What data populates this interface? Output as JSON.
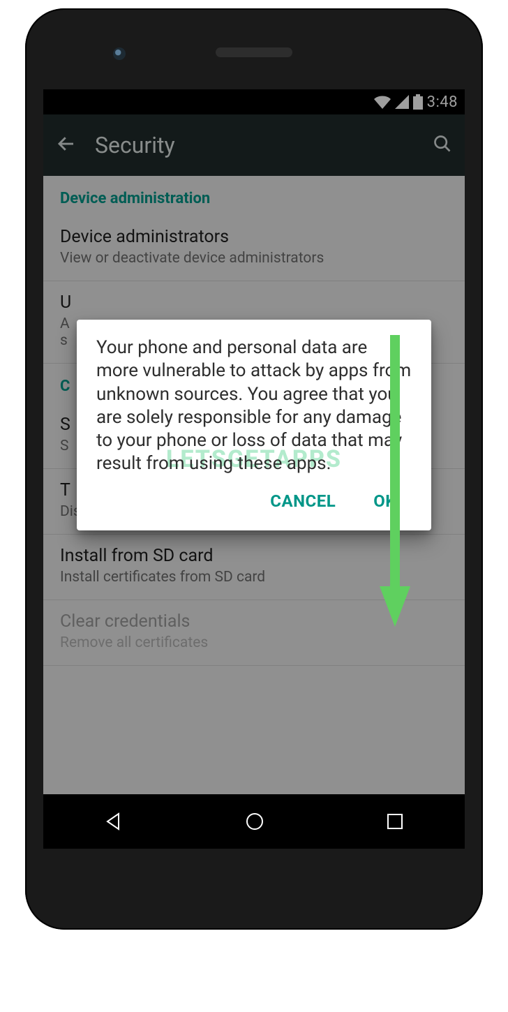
{
  "statusbar": {
    "time": "3:48"
  },
  "appbar": {
    "title": "Security"
  },
  "sections": {
    "admin_header": "Device administration",
    "cred_header_partial": "C"
  },
  "items": {
    "device_admins": {
      "title": "Device administrators",
      "subtitle": "View or deactivate device administrators"
    },
    "unknown_sources": {
      "title_partial": "U",
      "subtitle_line1_partial": "A",
      "subtitle_line2_partial": "s"
    },
    "storage_type": {
      "title_partial": "S",
      "subtitle_partial": "S"
    },
    "trusted_cred": {
      "title_partial": "T",
      "subtitle": "Display trusted CA certificates"
    },
    "install_sd": {
      "title": "Install from SD card",
      "subtitle": "Install certificates from SD card"
    },
    "clear_cred": {
      "title": "Clear credentials",
      "subtitle": "Remove all certificates"
    }
  },
  "dialog": {
    "message": "Your phone and personal data are more vulnerable to attack by apps from unknown sources. You agree that you are solely responsible for any damage to your phone or loss of data that may result from using these apps.",
    "cancel": "CANCEL",
    "ok": "OK"
  },
  "watermark": "LETSGETAPPS",
  "colors": {
    "accent": "#009688",
    "arrow": "#5fd05f"
  }
}
